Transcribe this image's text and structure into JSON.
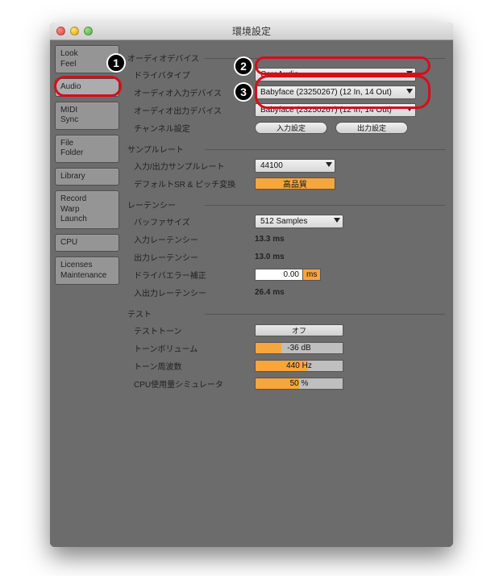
{
  "window": {
    "title": "環境設定"
  },
  "sidebar": {
    "tabs": [
      {
        "lines": [
          "Look",
          "Feel"
        ]
      },
      {
        "lines": [
          "Audio"
        ]
      },
      {
        "lines": [
          "MIDI",
          "Sync"
        ]
      },
      {
        "lines": [
          "File",
          "Folder"
        ]
      },
      {
        "lines": [
          "Library"
        ]
      },
      {
        "lines": [
          "Record",
          "Warp",
          "Launch"
        ]
      },
      {
        "lines": [
          "CPU"
        ]
      },
      {
        "lines": [
          "Licenses",
          "Maintenance"
        ]
      }
    ],
    "selected_index": 1
  },
  "sections": {
    "audio_device": {
      "title": "オーディオデバイス",
      "driver_type": {
        "label": "ドライバタイプ",
        "value": "CoreAudio"
      },
      "input_device": {
        "label": "オーディオ入力デバイス",
        "value": "Babyface (23250267) (12 In, 14 Out)"
      },
      "output_device": {
        "label": "オーディオ出力デバイス",
        "value": "Babyface (23250267) (12 In, 14 Out)"
      },
      "channel_config": {
        "label": "チャンネル設定",
        "input_btn": "入力設定",
        "output_btn": "出力設定"
      }
    },
    "sample_rate": {
      "title": "サンプルレート",
      "io_sr": {
        "label": "入力/出力サンプルレート",
        "value": "44100"
      },
      "default_sr": {
        "label": "デフォルトSR & ピッチ変換",
        "value": "高品質"
      }
    },
    "latency": {
      "title": "レーテンシー",
      "buffer": {
        "label": "バッファサイズ",
        "value": "512 Samples"
      },
      "in_latency": {
        "label": "入力レーテンシー",
        "value": "13.3 ms"
      },
      "out_latency": {
        "label": "出力レーテンシー",
        "value": "13.0 ms"
      },
      "driver_comp": {
        "label": "ドライバエラー補正",
        "value": "0.00",
        "unit": "ms"
      },
      "io_latency": {
        "label": "入出力レーテンシー",
        "value": "26.4 ms"
      }
    },
    "test": {
      "title": "テスト",
      "tone": {
        "label": "テストトーン",
        "value": "オフ"
      },
      "volume": {
        "label": "トーンボリューム",
        "value": "-36 dB",
        "fill": 30
      },
      "freq": {
        "label": "トーン周波数",
        "value": "440 Hz",
        "fill": 60
      },
      "cpu": {
        "label": "CPU使用量シミュレータ",
        "value": "50 %",
        "fill": 50
      }
    }
  },
  "annotations": {
    "1": "1",
    "2": "2",
    "3": "3"
  }
}
